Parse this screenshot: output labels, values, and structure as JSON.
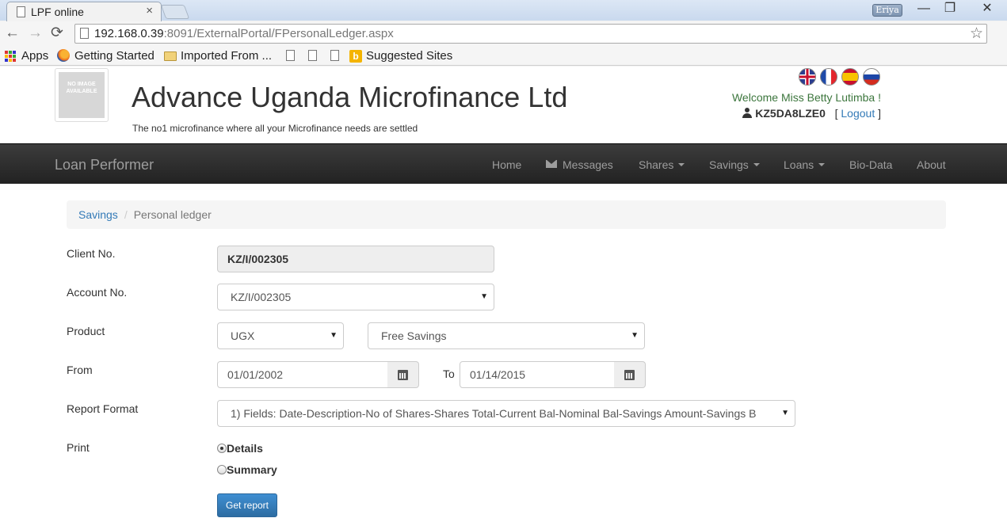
{
  "browser": {
    "tab_title": "LPF online",
    "tab_close": "×",
    "profile_name": "Eriya",
    "window_buttons": {
      "minimize": "—",
      "maximize": "❐",
      "close": "✕"
    },
    "url_host": "192.168.0.39",
    "url_rest": ":8091/ExternalPortal/FPersonalLedger.aspx",
    "back": "←",
    "forward": "→",
    "reload": "⟳",
    "star": "☆",
    "bookmarks": {
      "apps": "Apps",
      "getting_started": "Getting Started",
      "imported_from": "Imported From ...",
      "suggested_sites": "Suggested Sites",
      "bing_glyph": "b"
    }
  },
  "header": {
    "logo_text": "NO IMAGE AVAILABLE",
    "org_title": "Advance Uganda Microfinance Ltd",
    "tagline": "The no1 microfinance where all your Microfinance needs are settled",
    "welcome": "Welcome Miss Betty Lutimba !",
    "user_code": "KZ5DA8LZE0",
    "logout_open": "[",
    "logout": "Logout",
    "logout_close": "]",
    "flags": [
      "uk-flag-icon",
      "france-flag-icon",
      "spain-flag-icon",
      "russia-flag-icon"
    ]
  },
  "navbar": {
    "brand": "Loan Performer",
    "home": "Home",
    "messages": "Messages",
    "shares": "Shares",
    "savings": "Savings",
    "loans": "Loans",
    "biodata": "Bio-Data",
    "about": "About"
  },
  "breadcrumb": {
    "parent": "Savings",
    "separator": "/",
    "current": "Personal ledger"
  },
  "form": {
    "client_no_label": "Client No.",
    "client_no_value": "KZ/I/002305",
    "account_no_label": "Account No.",
    "account_no_value": "KZ/I/002305",
    "product_label": "Product",
    "currency_value": "UGX",
    "product_value": "Free Savings",
    "from_label": "From",
    "from_value": "01/01/2002",
    "to_label": "To",
    "to_value": "01/14/2015",
    "report_format_label": "Report Format",
    "report_format_value": "1) Fields: Date-Description-No of Shares-Shares Total-Current Bal-Nominal Bal-Savings Amount-Savings B",
    "print_label": "Print",
    "print_options": [
      {
        "label": "Details",
        "selected": true
      },
      {
        "label": "Summary",
        "selected": false
      }
    ],
    "submit": "Get report",
    "select_arrow": "▼"
  }
}
